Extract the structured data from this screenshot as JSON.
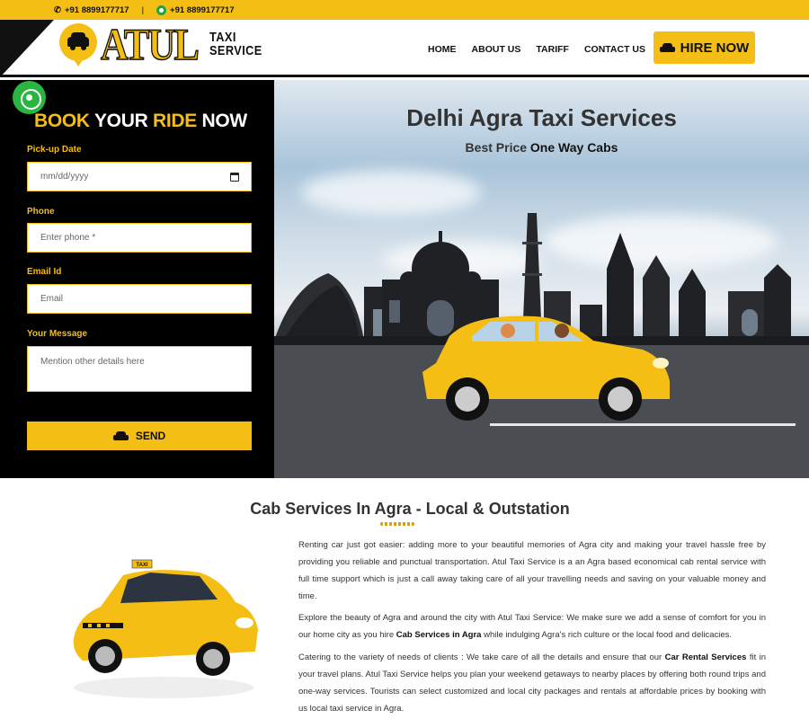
{
  "topbar": {
    "phone_1": "+91 8899177717",
    "separator": "|",
    "phone_2": "+91 8899177717"
  },
  "header": {
    "logo_main": "ATUL",
    "logo_line1": "TAXI",
    "logo_line2": "SERVICE",
    "nav": [
      "HOME",
      "ABOUT US",
      "TARIFF",
      "CONTACT US"
    ],
    "hire_label": "HIRE NOW"
  },
  "booking": {
    "title_part1": "BOOK",
    "title_part2": "YOUR",
    "title_part3": "RIDE",
    "title_part4": "NOW",
    "pickup_label": "Pick-up Date",
    "pickup_placeholder": "mm/dd/yyyy",
    "phone_label": "Phone",
    "phone_placeholder": "Enter phone *",
    "email_label": "Email Id",
    "email_placeholder": "Email",
    "message_label": "Your Message",
    "message_placeholder": "Mention other details here",
    "send_label": "SEND"
  },
  "hero": {
    "title": "Delhi Agra Taxi Services",
    "subtitle_plain": "Best Price ",
    "subtitle_bold": "One Way Cabs"
  },
  "section": {
    "title": "Cab Services In Agra - Local & Outstation",
    "p1": "Renting car just got easier: adding more to your beautiful memories of Agra city and making your travel hassle free by providing you reliable and punctual transportation. Atul Taxi Service is a an Agra based economical cab rental service with full time support which is just a call away taking care of all your travelling needs and saving on your valuable money and time.",
    "p2_a": "Explore the beauty of Agra and around the city with Atul Taxi Service: We make sure we add a sense of comfort for you in our home city as you hire ",
    "p2_b": "Cab Services in Agra",
    "p2_c": " while indulging Agra's rich culture or the local food and delicacies.",
    "p3_a": "Catering to the variety of needs of clients : We take care of all the details and ensure that our ",
    "p3_b": "Car Rental Services",
    "p3_c": " fit in your travel plans. Atul Taxi Service helps you plan your weekend getaways to nearby places by offering both round trips and one-way services. Tourists can select customized and local city packages and rentals at affordable prices by booking with us local taxi service in Agra.",
    "taxi_sign": "TAXI"
  },
  "colors": {
    "accent": "#f5be14",
    "dark": "#000000",
    "whatsapp": "#2ab540"
  },
  "icons": [
    "phone-icon",
    "whatsapp-icon",
    "car-icon",
    "calendar-icon",
    "whatsapp-float-icon"
  ]
}
